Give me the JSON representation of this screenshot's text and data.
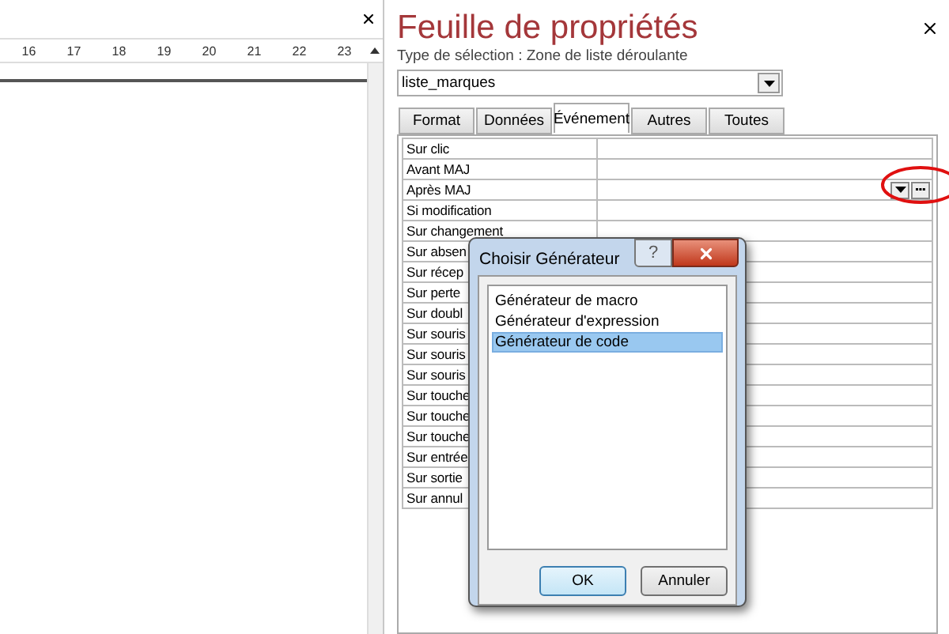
{
  "form_pane": {
    "ruler": [
      "16",
      "17",
      "18",
      "19",
      "20",
      "21",
      "22",
      "23"
    ]
  },
  "property_sheet": {
    "title": "Feuille de propriétés",
    "selection_type": "Type de sélection :  Zone de liste déroulante",
    "object_combo": "liste_marques",
    "tabs": [
      {
        "label": "Format",
        "selected": false
      },
      {
        "label": "Données",
        "selected": false
      },
      {
        "label": "Événement",
        "selected": true
      },
      {
        "label": "Autres",
        "selected": false
      },
      {
        "label": "Toutes",
        "selected": false
      }
    ],
    "rows": [
      {
        "label": "Sur clic",
        "builder_buttons": false
      },
      {
        "label": "Avant MAJ",
        "builder_buttons": false
      },
      {
        "label": "Après MAJ",
        "builder_buttons": true
      },
      {
        "label": "Si modification",
        "builder_buttons": false
      },
      {
        "label": "Sur changement",
        "builder_buttons": false
      },
      {
        "label": "Sur absen",
        "builder_buttons": false
      },
      {
        "label": "Sur récep",
        "builder_buttons": false
      },
      {
        "label": "Sur perte",
        "builder_buttons": false
      },
      {
        "label": "Sur doubl",
        "builder_buttons": false
      },
      {
        "label": "Sur souris",
        "builder_buttons": false
      },
      {
        "label": "Sur souris",
        "builder_buttons": false
      },
      {
        "label": "Sur souris",
        "builder_buttons": false
      },
      {
        "label": "Sur touche",
        "builder_buttons": false
      },
      {
        "label": "Sur touche",
        "builder_buttons": false
      },
      {
        "label": "Sur touche",
        "builder_buttons": false
      },
      {
        "label": "Sur entrée",
        "builder_buttons": false
      },
      {
        "label": "Sur sortie",
        "builder_buttons": false
      },
      {
        "label": "Sur annul",
        "builder_buttons": false
      }
    ]
  },
  "dialog": {
    "title": "Choisir Générateur",
    "help": "?",
    "items": [
      {
        "label": "Générateur de macro",
        "selected": false
      },
      {
        "label": "Générateur d'expression",
        "selected": false
      },
      {
        "label": "Générateur de code",
        "selected": true
      }
    ],
    "buttons": [
      {
        "label": "OK",
        "default": true
      },
      {
        "label": "Annuler",
        "default": false
      }
    ]
  }
}
